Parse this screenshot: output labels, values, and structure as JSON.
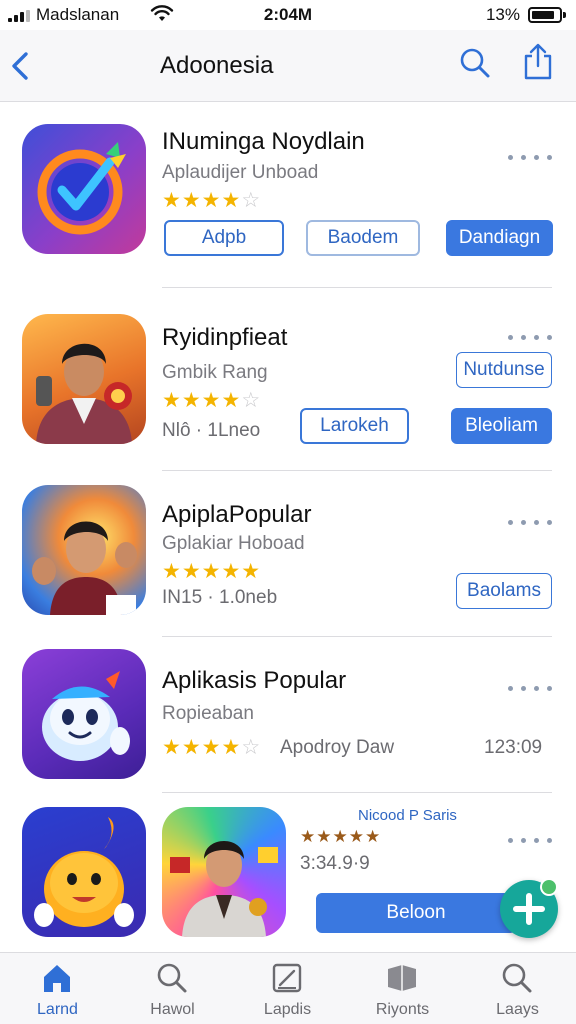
{
  "status_bar": {
    "carrier": "Madslanan",
    "time": "2:04M",
    "battery": "13%"
  },
  "nav": {
    "title": "Adoonesia",
    "icons": [
      "back-chevron-icon",
      "search-icon",
      "share-icon"
    ]
  },
  "apps": [
    {
      "name": "INuminga Noydlain",
      "subtitle": "Aplaudijer Unboad",
      "stars": "★★★★",
      "stars_off": "☆",
      "buttons": [
        "Adpb",
        "Baodem",
        "Dandiagn"
      ]
    },
    {
      "name": "Ryidinpfieat",
      "subtitle": "Gmbik Rang",
      "stars": "★★★★",
      "stars_off": "☆",
      "meta": "Nlô · 1Lneo",
      "chip": "Nutdunse",
      "buttons": [
        "Larokeh",
        "Bleoliam"
      ]
    },
    {
      "name": "ApiplaPopular",
      "subtitle": "Gplakiar Hoboad",
      "stars": "★★★★★",
      "stars_off": "",
      "meta": "IN15 · 1.0neb",
      "chip": "Baolams"
    },
    {
      "name": "Aplikasis Popular",
      "subtitle": "Ropieaban",
      "stars": "★★★★",
      "stars_off": "☆",
      "rating_text": "Apodroy Daw",
      "time": "123:09"
    },
    {
      "name": "Nicood P Saris",
      "stars": "★★★★★",
      "stars_off": "",
      "meta": "3:34.9·9",
      "button": "Beloon"
    }
  ],
  "tabs": [
    {
      "label": "Larnd",
      "icon": "home-icon",
      "active": true
    },
    {
      "label": "Hawol",
      "icon": "search-icon",
      "active": false
    },
    {
      "label": "Lapdis",
      "icon": "edit-icon",
      "active": false
    },
    {
      "label": "Riyonts",
      "icon": "games-icon",
      "active": false
    },
    {
      "label": "Laays",
      "icon": "search-icon",
      "active": false
    }
  ],
  "colors": {
    "accent": "#3a78e0",
    "star": "#f4b400",
    "fab": "#16a79a"
  }
}
